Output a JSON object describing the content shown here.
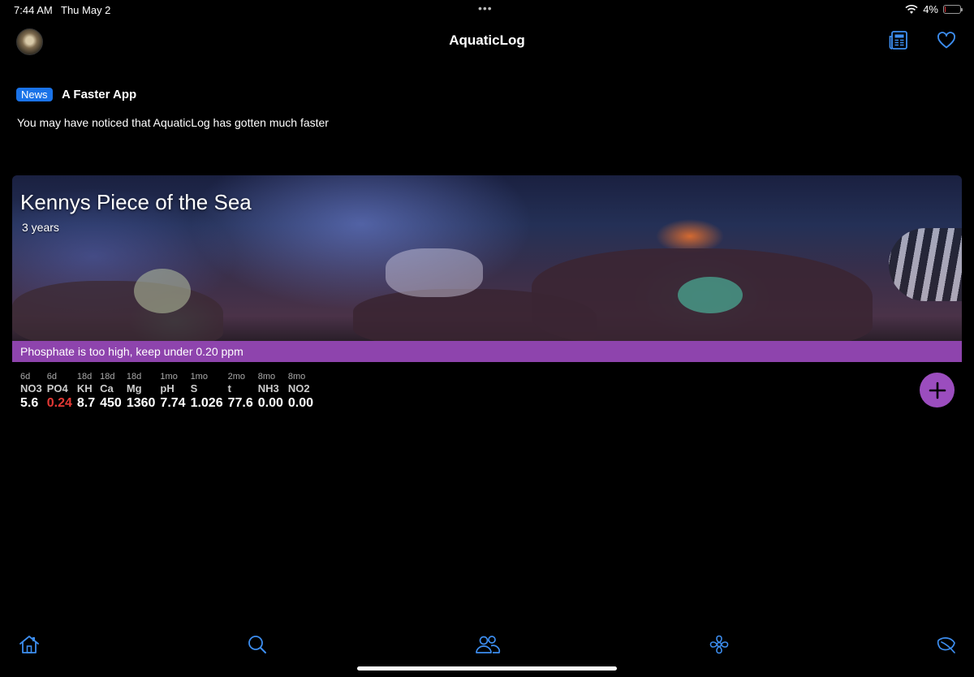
{
  "status": {
    "time": "7:44 AM",
    "date": "Thu May 2",
    "battery": "4%",
    "battery_level": 0.04
  },
  "nav": {
    "title": "AquaticLog"
  },
  "news": {
    "badge": "News",
    "title": "A Faster App",
    "body": "You may have noticed that AquaticLog has gotten much faster"
  },
  "tank": {
    "name": "Kennys Piece of the Sea",
    "age": "3 years",
    "alert": "Phosphate is too high, keep under 0.20 ppm"
  },
  "params": [
    {
      "age": "6d",
      "name": "NO3",
      "value": "5.6",
      "alert": false
    },
    {
      "age": "6d",
      "name": "PO4",
      "value": "0.24",
      "alert": true
    },
    {
      "age": "18d",
      "name": "KH",
      "value": "8.7",
      "alert": false
    },
    {
      "age": "18d",
      "name": "Ca",
      "value": "450",
      "alert": false
    },
    {
      "age": "18d",
      "name": "Mg",
      "value": "1360",
      "alert": false
    },
    {
      "age": "1mo",
      "name": "pH",
      "value": "7.74",
      "alert": false
    },
    {
      "age": "1mo",
      "name": "S",
      "value": "1.026",
      "alert": false
    },
    {
      "age": "2mo",
      "name": "t",
      "value": "77.6",
      "alert": false
    },
    {
      "age": "8mo",
      "name": "NH3",
      "value": "0.00",
      "alert": false
    },
    {
      "age": "8mo",
      "name": "NO2",
      "value": "0.00",
      "alert": false
    }
  ],
  "icons": {
    "accent": "#3d8ef0",
    "alert_color": "#8e44ad",
    "add_button_color": "#9b4dbe",
    "tabs": [
      "home-icon",
      "search-icon",
      "community-icon",
      "fan-icon",
      "leaf-icon"
    ]
  }
}
